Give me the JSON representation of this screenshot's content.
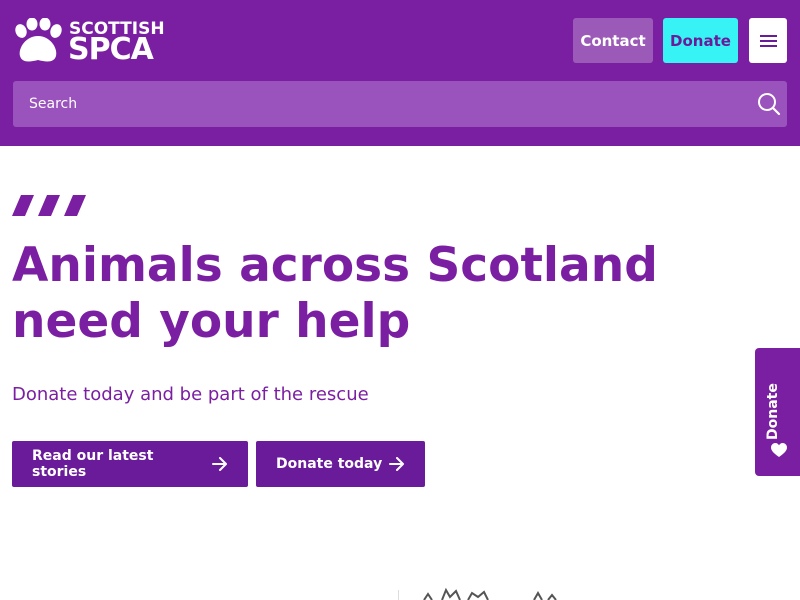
{
  "header": {
    "logo": {
      "line1": "SCOTTISH",
      "line2": "SPCA",
      "icon": "paw-icon"
    },
    "contact_label": "Contact",
    "donate_label": "Donate",
    "menu_icon": "hamburger-menu-icon",
    "search": {
      "placeholder": "Search",
      "icon": "search-icon"
    }
  },
  "hero": {
    "headline": "Animals across Scotland need your help",
    "subtitle": "Donate today and be part of the rescue",
    "buttons": [
      {
        "label": "Read our latest stories",
        "icon": "arrow-right-icon"
      },
      {
        "label": "Donate today",
        "icon": "arrow-right-icon"
      }
    ]
  },
  "side_tab": {
    "label": "Donate",
    "icon": "heart-icon"
  },
  "colors": {
    "brand_purple": "#7b1fa2",
    "dark_purple": "#6a1b9a",
    "cyan_accent": "#38f3f5",
    "search_bg": "#9a52bd"
  }
}
